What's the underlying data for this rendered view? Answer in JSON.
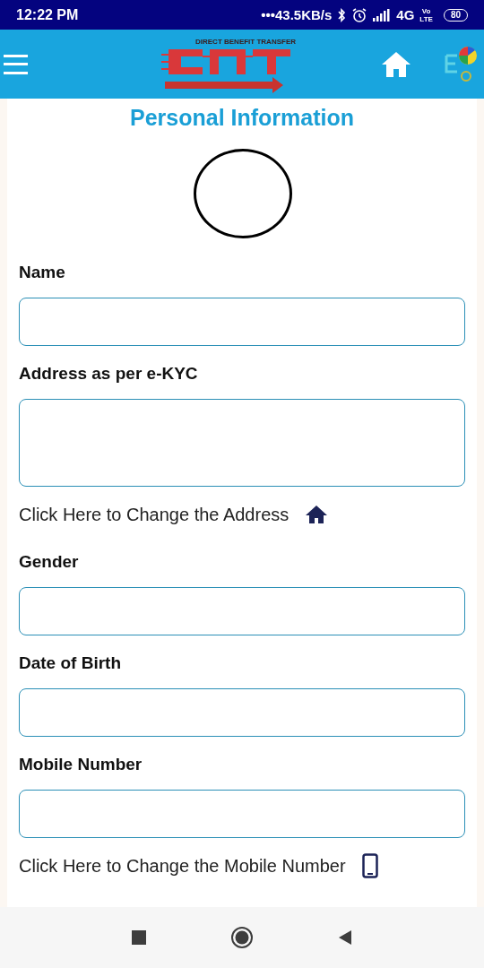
{
  "status_bar": {
    "time": "12:22 PM",
    "network_speed": "•••43.5KB/s",
    "network": "4G",
    "volte_top": "Vo",
    "volte_bottom": "LTE",
    "battery": "80"
  },
  "header": {
    "logo_caption": "DIRECT BENEFIT TRANSFER"
  },
  "title": "Personal Information",
  "fields": [
    {
      "label": "Name",
      "kind": "single"
    },
    {
      "label": "Address as per e-KYC",
      "kind": "multi",
      "link": {
        "text": "Click Here to Change the Address",
        "kind": "address"
      }
    },
    {
      "label": "Gender",
      "kind": "single"
    },
    {
      "label": "Date of Birth",
      "kind": "single"
    },
    {
      "label": "Mobile Number",
      "kind": "single",
      "link": {
        "text": "Click Here to Change the Mobile Number",
        "kind": "mobile"
      }
    }
  ]
}
